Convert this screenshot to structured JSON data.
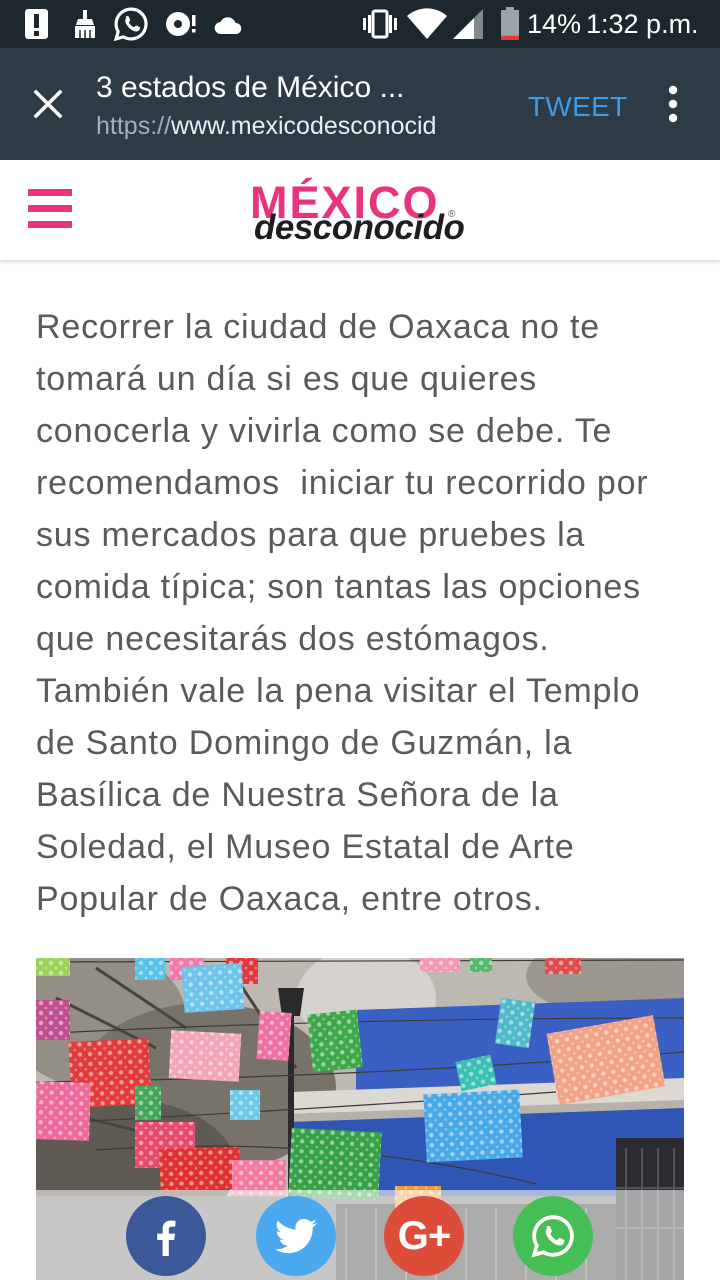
{
  "status_bar": {
    "left_icons": [
      "alert-icon",
      "cleaner-icon",
      "whatsapp-icon",
      "sync-error-icon",
      "cloud-icon"
    ],
    "right_icons": [
      "vibrate-icon",
      "wifi-icon",
      "signal-icon",
      "battery-icon"
    ],
    "battery_text": "14%",
    "battery_level": 0.14,
    "time": "1:32 p.m."
  },
  "browser_toolbar": {
    "close_icon": "close-icon",
    "title": "3 estados de México ...",
    "url_scheme": "https://",
    "url_host": "www.mexicodesconocid",
    "tweet_label": "TWEET",
    "menu_icon": "more-vert-icon"
  },
  "site_header": {
    "menu_icon": "hamburger-icon",
    "logo_top": "MÉXICO",
    "logo_bottom": "desconocido",
    "logo_mark": "®"
  },
  "article": {
    "paragraph_lines": [
      "Recorrer la ciudad de Oaxaca no te",
      "tomará un día si es que quieres",
      "conocerla y vivirla como se debe. Te",
      "recomendamos  iniciar tu recorrido por",
      "sus mercados para que pruebes la",
      "comida típica; son tantas las opciones",
      "que necesitarás dos estómagos.",
      "También vale la pena visitar el Templo",
      "de Santo Domingo de Guzmán, la",
      "Basílica de Nuestra Señora de la",
      "Soledad, el Museo Estatal de Arte",
      "Popular de Oaxaca, entre otros."
    ]
  },
  "share_bar": {
    "buttons": [
      {
        "icon": "facebook-icon",
        "color": "#3b5998"
      },
      {
        "icon": "twitter-icon",
        "color": "#4aa8ee"
      },
      {
        "icon": "google-plus-icon",
        "glyph": "G+",
        "color": "#dd4b39"
      },
      {
        "icon": "whatsapp-icon",
        "color": "#45be55"
      }
    ]
  },
  "colors": {
    "status_bar_bg": "#1d282e",
    "toolbar_bg": "#2d3b45",
    "tweet": "#3d9be9",
    "brand_pink": "#e8337d",
    "body_text": "#5a5a5a"
  }
}
